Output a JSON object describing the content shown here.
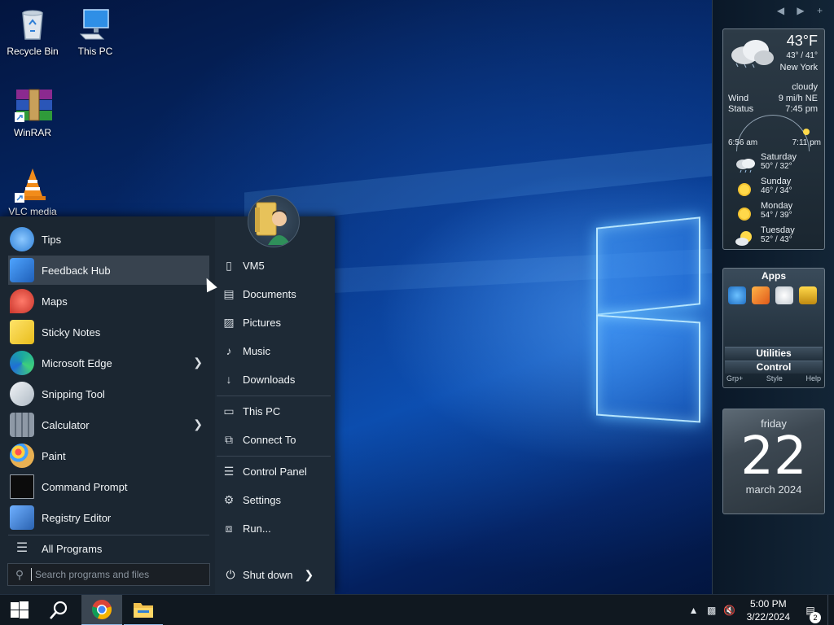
{
  "desktop": {
    "icons": [
      {
        "label": "Recycle Bin"
      },
      {
        "label": "This PC"
      },
      {
        "label": "WinRAR"
      },
      {
        "label": "VLC media"
      }
    ]
  },
  "sidebar": {
    "nav": "◀ ▶ +",
    "weather": {
      "temp": "43°F",
      "hilo": "43° / 41°",
      "city": "New York",
      "condition": "cloudy",
      "wind_label": "Wind",
      "wind_value": "9 mi/h NE",
      "status_label": "Status",
      "status_value": "7:45 pm",
      "sunrise": "6:56 am",
      "sunset": "7:11 pm",
      "forecast": [
        {
          "day": "Saturday",
          "temps": "50° / 32°",
          "icon": "cloud-rain-icon"
        },
        {
          "day": "Sunday",
          "temps": "46° / 34°",
          "icon": "sun-icon"
        },
        {
          "day": "Monday",
          "temps": "54° / 39°",
          "icon": "sun-icon"
        },
        {
          "day": "Tuesday",
          "temps": "52° / 43°",
          "icon": "partly-cloudy-icon"
        }
      ]
    },
    "apps": {
      "title": "Apps",
      "utilities": "Utilities",
      "control": "Control",
      "footer": [
        "Grp+",
        "Style",
        "Help"
      ]
    },
    "calendar": {
      "weekday": "friday",
      "day": "22",
      "month_year": "march 2024"
    }
  },
  "start_menu": {
    "apps": [
      {
        "label": "Tips",
        "icon": "tips-icon",
        "color": "#3b8ede"
      },
      {
        "label": "Feedback Hub",
        "icon": "feedback-hub-icon",
        "color": "#2f7fd6"
      },
      {
        "label": "Maps",
        "icon": "maps-icon",
        "color": "#d9473a"
      },
      {
        "label": "Sticky Notes",
        "icon": "sticky-notes-icon",
        "color": "#f5d33b"
      },
      {
        "label": "Microsoft Edge",
        "icon": "edge-icon",
        "color": "#1ba7a0"
      },
      {
        "label": "Snipping Tool",
        "icon": "snipping-tool-icon",
        "color": "#c8d2dc"
      },
      {
        "label": "Calculator",
        "icon": "calculator-icon",
        "color": "#6b7785"
      },
      {
        "label": "Paint",
        "icon": "paint-icon",
        "color": "#e8b052"
      },
      {
        "label": "Command Prompt",
        "icon": "command-prompt-icon",
        "color": "#0c0c0c"
      },
      {
        "label": "Registry Editor",
        "icon": "registry-editor-icon",
        "color": "#3b79c8"
      }
    ],
    "all_programs": "All Programs",
    "search_placeholder": "Search programs and files",
    "places": [
      {
        "label": "VM5",
        "icon": "user-folder-icon",
        "glyph": "▯"
      },
      {
        "label": "Documents",
        "icon": "documents-icon",
        "glyph": "▤"
      },
      {
        "label": "Pictures",
        "icon": "pictures-icon",
        "glyph": "▨"
      },
      {
        "label": "Music",
        "icon": "music-icon",
        "glyph": "♪"
      },
      {
        "label": "Downloads",
        "icon": "downloads-icon",
        "glyph": "↓"
      },
      {
        "label": "This PC",
        "icon": "this-pc-icon",
        "glyph": "▭"
      },
      {
        "label": "Connect To",
        "icon": "connect-to-icon",
        "glyph": "⧉"
      },
      {
        "label": "Control Panel",
        "icon": "control-panel-icon",
        "glyph": "☰"
      },
      {
        "label": "Settings",
        "icon": "settings-icon",
        "glyph": "⚙"
      },
      {
        "label": "Run...",
        "icon": "run-icon",
        "glyph": "⧈"
      }
    ],
    "shutdown": "Shut down"
  },
  "taskbar": {
    "time": "5:00 PM",
    "date": "3/22/2024",
    "notifications": "2"
  }
}
